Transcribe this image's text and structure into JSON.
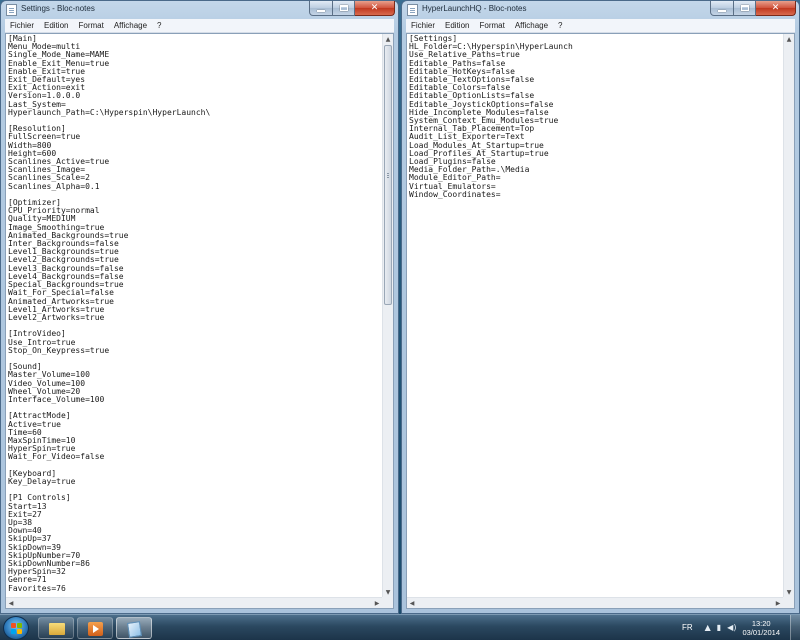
{
  "windows": {
    "left": {
      "title": "Settings - Bloc-notes",
      "menu": [
        "Fichier",
        "Edition",
        "Format",
        "Affichage",
        "?"
      ],
      "content": "[Main]\nMenu_Mode=multi\nSingle_Mode_Name=MAME\nEnable_Exit_Menu=true\nEnable_Exit=true\nExit_Default=yes\nExit_Action=exit\nVersion=1.0.0.0\nLast_System=\nHyperlaunch_Path=C:\\Hyperspin\\HyperLaunch\\\n\n[Resolution]\nFullScreen=true\nWidth=800\nHeight=600\nScanlines_Active=true\nScanlines_Image=\nScanlines_Scale=2\nScanlines_Alpha=0.1\n\n[Optimizer]\nCPU_Priority=normal\nQuality=MEDIUM\nImage_Smoothing=true\nAnimated_Backgrounds=true\nInter_Backgrounds=false\nLevel1_Backgrounds=true\nLevel2_Backgrounds=true\nLevel3_Backgrounds=false\nLevel4_Backgrounds=false\nSpecial_Backgrounds=true\nWait_For_Special=false\nAnimated_Artworks=true\nLevel1_Artworks=true\nLevel2_Artworks=true\n\n[IntroVideo]\nUse_Intro=true\nStop_On_Keypress=true\n\n[Sound]\nMaster_Volume=100\nVideo_Volume=100\nWheel_Volume=20\nInterface_Volume=100\n\n[AttractMode]\nActive=true\nTime=60\nMaxSpinTime=10\nHyperSpin=true\nWait_For_Video=false\n\n[Keyboard]\nKey_Delay=true\n\n[P1 Controls]\nStart=13\nExit=27\nUp=38\nDown=40\nSkipUp=37\nSkipDown=39\nSkipUpNumber=70\nSkipDownNumber=86\nHyperSpin=32\nGenre=71\nFavorites=76"
    },
    "right": {
      "title": "HyperLaunchHQ - Bloc-notes",
      "menu": [
        "Fichier",
        "Edition",
        "Format",
        "Affichage",
        "?"
      ],
      "content": "[Settings]\nHL_Folder=C:\\Hyperspin\\HyperLaunch\nUse_Relative_Paths=true\nEditable_Paths=false\nEditable_HotKeys=false\nEditable_TextOptions=false\nEditable_Colors=false\nEditable_OptionLists=false\nEditable_JoystickOptions=false\nHide_Incomplete_Modules=false\nSystem_Context_Emu_Modules=true\nInternal_Tab_Placement=Top\nAudit_List_Exporter=Text\nLoad_Modules_At_Startup=true\nLoad_Profiles_At_Startup=true\nLoad_Plugins=false\nMedia_Folder_Path=.\\Media\nModule_Editor_Path=\nVirtual_Emulators=\nWindow_Coordinates="
    }
  },
  "caption_glyphs": {
    "close": "✕"
  },
  "scroll_glyphs": {
    "up": "▲",
    "down": "▼",
    "left": "◀",
    "right": "▶"
  },
  "taskbar": {
    "pinned_icons": [
      "explorer-folder-icon",
      "media-player-icon",
      "notepad-icon"
    ],
    "language": "FR",
    "time": "13:20",
    "date": "03/01/2014",
    "tray_icons": {
      "up_arrow": "▲",
      "network": "▮",
      "volume": "◀)"
    }
  },
  "colors": {
    "title_bar": "#b3cbe2",
    "close_button": "#c0381f",
    "taskbar": "#2b4860",
    "desktop": "#24587a"
  }
}
